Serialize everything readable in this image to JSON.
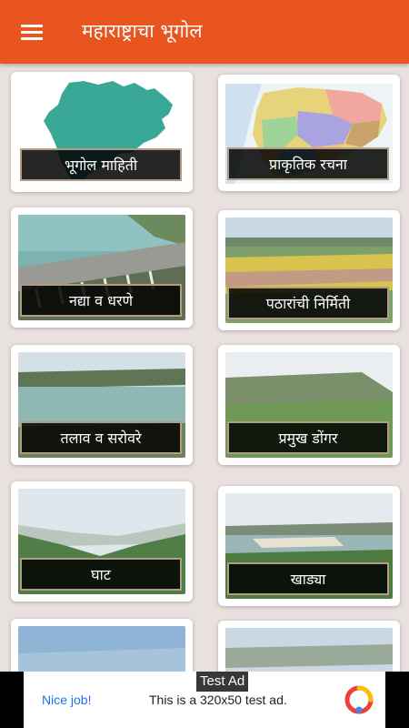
{
  "app": {
    "title": "महाराष्ट्राचा भूगोल",
    "accent": "#e8551f"
  },
  "cards": [
    {
      "label": "भूगोल माहिती"
    },
    {
      "label": "प्राकृतिक रचना"
    },
    {
      "label": "नद्या व धरणे"
    },
    {
      "label": "पठारांची निर्मिती"
    },
    {
      "label": "तलाव व सरोवरे"
    },
    {
      "label": "प्रमुख डोंगर"
    },
    {
      "label": "घाट"
    },
    {
      "label": "खाड्या"
    }
  ],
  "ad": {
    "badge": "Test Ad",
    "nice": "Nice job!",
    "text": "This is a 320x50 test ad."
  }
}
